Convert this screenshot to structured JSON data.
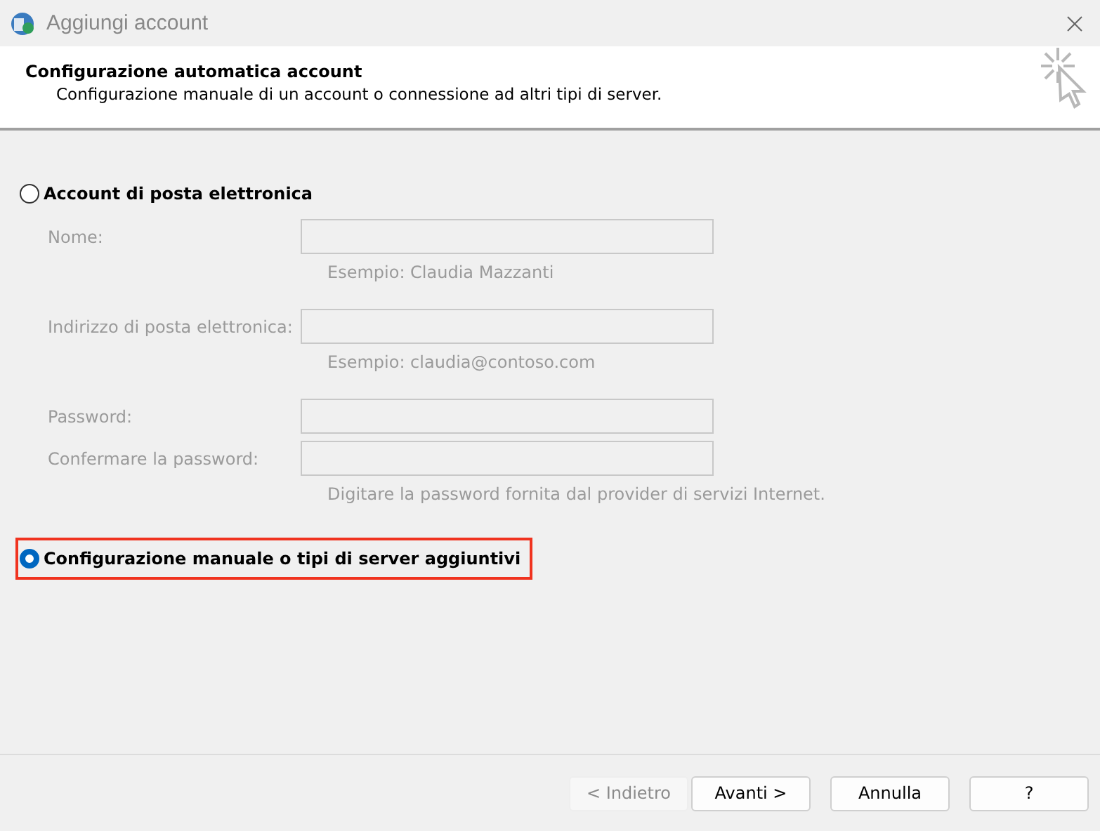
{
  "window": {
    "title": "Aggiungi account"
  },
  "header": {
    "title": "Configurazione automatica account",
    "subtitle": "Configurazione manuale di un account o connessione ad altri tipi di server."
  },
  "options": [
    {
      "label": "Account di posta elettronica",
      "selected": false,
      "highlighted": false,
      "fields": [
        {
          "label": "Nome:",
          "disabled": true,
          "hint": "Esempio: Claudia Mazzanti"
        },
        {
          "label": "Indirizzo di posta elettronica:",
          "disabled": true,
          "hint": "Esempio: claudia@contoso.com"
        },
        {
          "label": "Password:",
          "disabled": true
        },
        {
          "label": "Confermare la password:",
          "disabled": true,
          "hint": "Digitare la password fornita dal provider di servizi Internet."
        }
      ]
    },
    {
      "label": "Configurazione manuale o tipi di server aggiuntivi",
      "selected": true,
      "highlighted": true
    }
  ],
  "buttons": [
    {
      "label": "< Indietro",
      "disabled": true
    },
    {
      "label": "Avanti >",
      "disabled": false
    },
    {
      "label": "Annulla",
      "disabled": false
    },
    {
      "label": "?",
      "disabled": false
    }
  ]
}
